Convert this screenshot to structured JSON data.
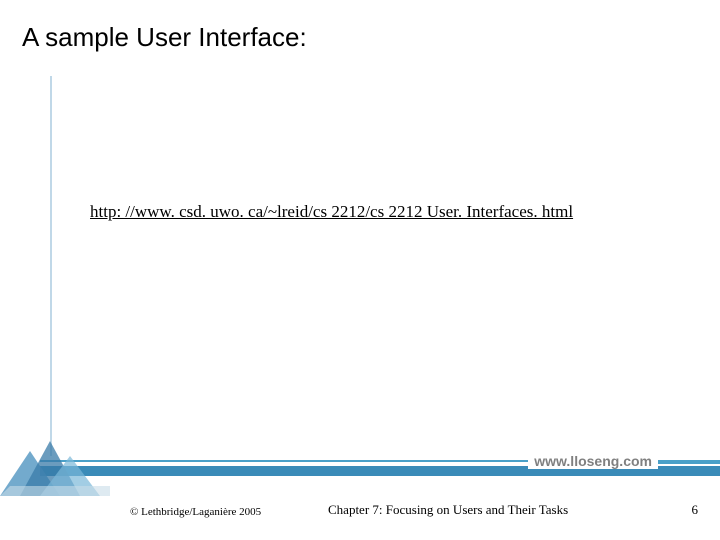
{
  "title": "A sample User Interface:",
  "link_text": "http: //www. csd. uwo. ca/~lreid/cs 2212/cs 2212 User. Interfaces. html",
  "footer_url": "www.lloseng.com",
  "copyright": "© Lethbridge/Laganière 2005",
  "chapter": "Chapter 7: Focusing on Users and Their Tasks",
  "page_number": "6"
}
